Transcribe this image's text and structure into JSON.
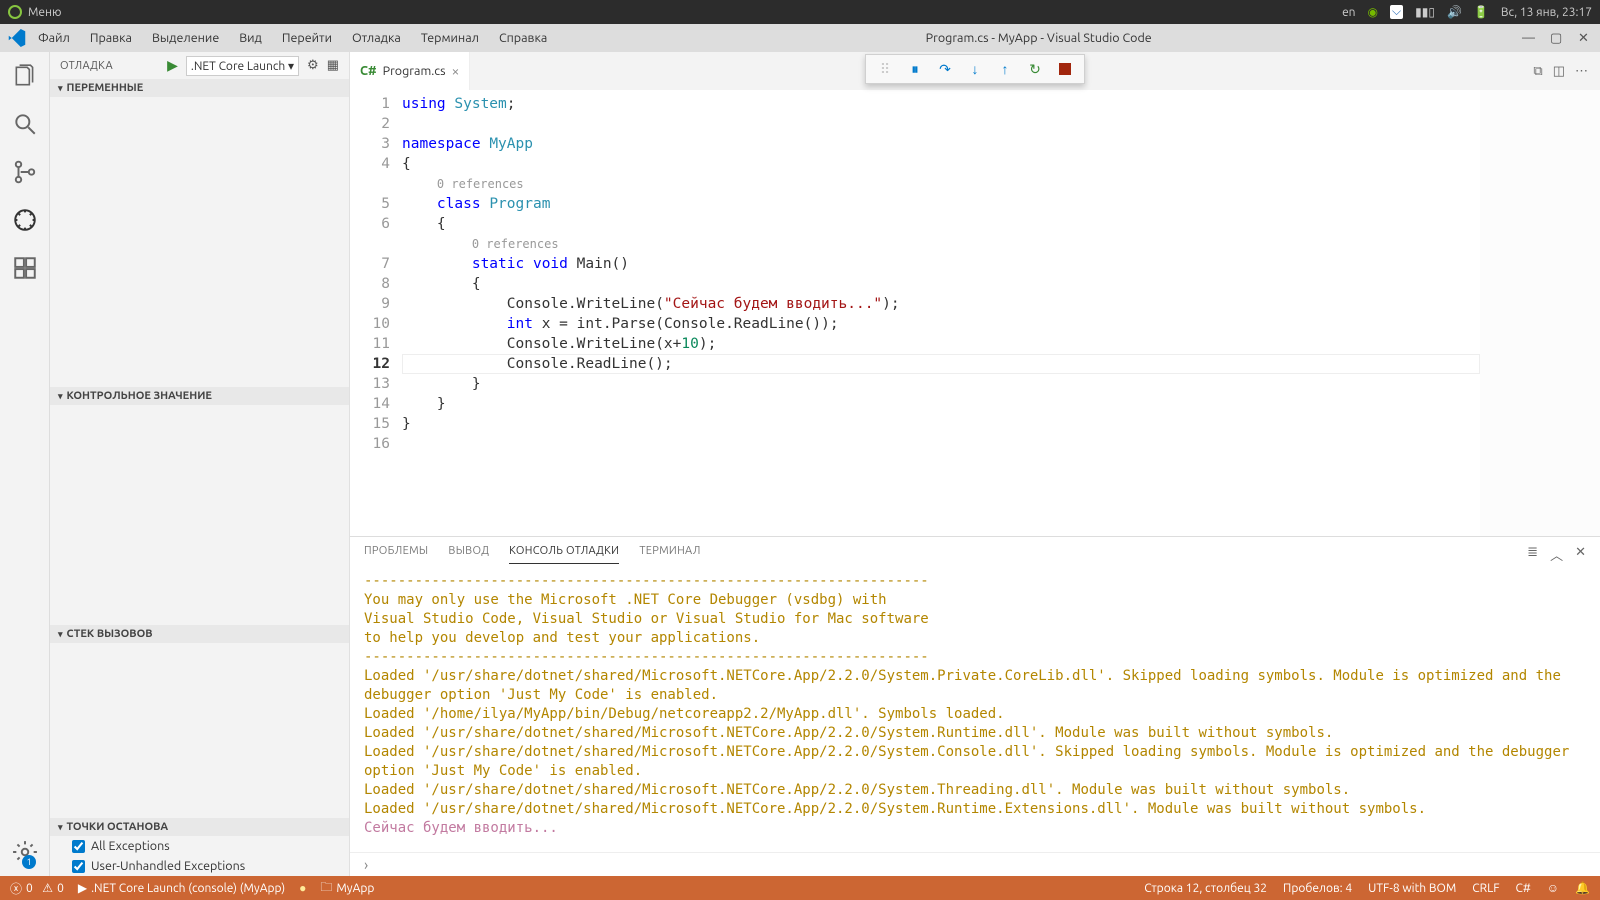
{
  "os": {
    "menu_label": "Меню",
    "lang": "en",
    "clock": "Вс, 13 янв, 23:17"
  },
  "titlebar": {
    "menu": [
      "Файл",
      "Правка",
      "Выделение",
      "Вид",
      "Перейти",
      "Отладка",
      "Терминал",
      "Справка"
    ],
    "title": "Program.cs - MyApp - Visual Studio Code"
  },
  "sidebar": {
    "view_title": "ОТЛАДКА",
    "launch_config": ".NET Core Launch ▾",
    "sections": {
      "variables": "ПЕРЕМЕННЫЕ",
      "watch": "КОНТРОЛЬНОЕ ЗНАЧЕНИЕ",
      "callstack": "СТЕК ВЫЗОВОВ",
      "breakpoints": "ТОЧКИ ОСТАНОВА"
    },
    "breakpoints": {
      "all_ex": "All Exceptions",
      "user_ex": "User-Unhandled Exceptions"
    }
  },
  "tabs": {
    "file": "Program.cs"
  },
  "code": {
    "lines": [
      "1",
      "2",
      "3",
      "4",
      "5",
      "6",
      "7",
      "8",
      "9",
      "10",
      "11",
      "12",
      "13",
      "14",
      "15",
      "16"
    ],
    "codelens": "0 references",
    "tokens": {
      "using": "using",
      "system": "System",
      "namespace": "namespace",
      "myapp": "MyApp",
      "class": "class",
      "program": "Program",
      "static": "static",
      "void": "void",
      "main": "Main",
      "console": "Console",
      "writeline": "WriteLine",
      "string1": "\"Сейчас будем вводить...\"",
      "int": "int",
      "x": "x",
      "intparse": "int.Parse",
      "readline": "ReadLine",
      "ten": "10"
    }
  },
  "panel": {
    "tabs": {
      "problems": "ПРОБЛЕМЫ",
      "output": "ВЫВОД",
      "debug": "КОНСОЛЬ ОТЛАДКИ",
      "terminal": "ТЕРМИНАЛ"
    },
    "sep": "-------------------------------------------------------------------",
    "l1": "You may only use the Microsoft .NET Core Debugger (vsdbg) with",
    "l2": "Visual Studio Code, Visual Studio or Visual Studio for Mac software",
    "l3": "to help you develop and test your applications.",
    "l4": "Loaded '/usr/share/dotnet/shared/Microsoft.NETCore.App/2.2.0/System.Private.CoreLib.dll'. Skipped loading symbols. Module is optimized and the debugger option 'Just My Code' is enabled.",
    "l5": "Loaded '/home/ilya/MyApp/bin/Debug/netcoreapp2.2/MyApp.dll'. Symbols loaded.",
    "l6": "Loaded '/usr/share/dotnet/shared/Microsoft.NETCore.App/2.2.0/System.Runtime.dll'. Module was built without symbols.",
    "l7": "Loaded '/usr/share/dotnet/shared/Microsoft.NETCore.App/2.2.0/System.Console.dll'. Skipped loading symbols. Module is optimized and the debugger option 'Just My Code' is enabled.",
    "l8": "Loaded '/usr/share/dotnet/shared/Microsoft.NETCore.App/2.2.0/System.Threading.dll'. Module was built without symbols.",
    "l9": "Loaded '/usr/share/dotnet/shared/Microsoft.NETCore.App/2.2.0/System.Runtime.Extensions.dll'. Module was built without symbols.",
    "out": "Сейчас будем вводить..."
  },
  "statusbar": {
    "err": "0",
    "warn": "0",
    "launch": ".NET Core Launch (console) (MyApp)",
    "folder": "MyApp",
    "pos": "Строка 12, столбец 32",
    "spaces": "Пробелов: 4",
    "enc": "UTF-8 with BOM",
    "eol": "CRLF",
    "lang": "C#"
  },
  "settings_badge": "1"
}
